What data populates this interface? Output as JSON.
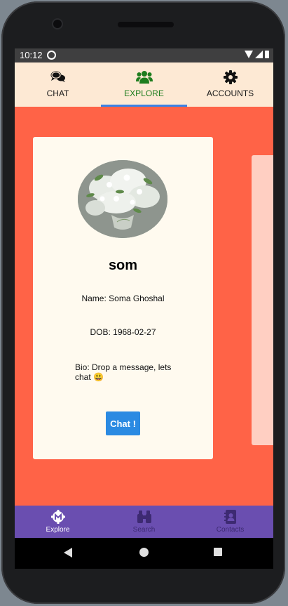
{
  "status": {
    "time": "10:12"
  },
  "tabs": [
    {
      "label": "CHAT",
      "icon": "comments-icon"
    },
    {
      "label": "EXPLORE",
      "icon": "users-icon",
      "active": true
    },
    {
      "label": "ACCOUNTS",
      "icon": "gear-icon"
    }
  ],
  "profile": {
    "username": "som",
    "name": "Name: Soma Ghoshal",
    "dob": "DOB: 1968-02-27",
    "bio": "Bio: Drop a message, lets chat 😃",
    "chat_button": "Chat !",
    "avatar_icon": "flower-photo-avatar"
  },
  "bottom_nav": [
    {
      "label": "Explore",
      "icon": "explore-icon",
      "active": true
    },
    {
      "label": "Search",
      "icon": "binoculars-icon"
    },
    {
      "label": "Contacts",
      "icon": "contacts-icon"
    }
  ],
  "colors": {
    "tab_bg": "#fde9d4",
    "content_bg": "#ff6347",
    "card_bg": "#fffaef",
    "accent_green": "#1e7d1e",
    "indicator_blue": "#3b82e5",
    "chat_button": "#2b8ae2",
    "bottom_nav": "#6a4eb0"
  }
}
